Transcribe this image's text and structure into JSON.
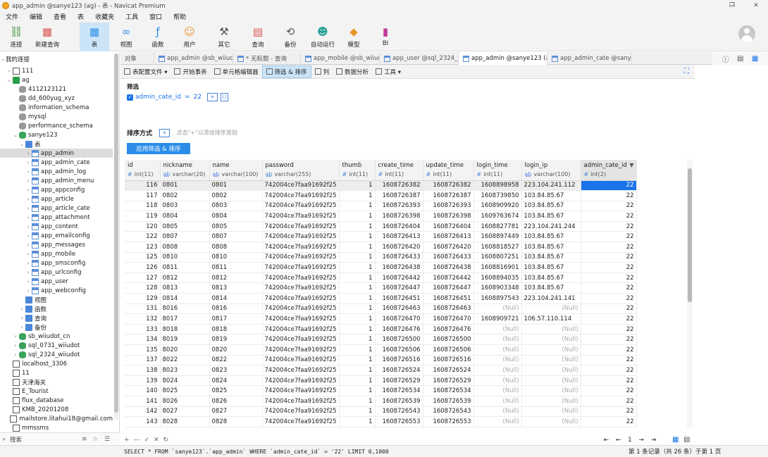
{
  "window": {
    "title": "app_admin @sanye123 (ag) - 表 - Navicat Premium",
    "controls": [
      "—",
      "❐",
      "✕"
    ]
  },
  "menu": [
    "文件",
    "编辑",
    "查看",
    "表",
    "收藏夹",
    "工具",
    "窗口",
    "帮助"
  ],
  "toolbar": [
    {
      "label": "连接",
      "icon": "connection-icon"
    },
    {
      "label": "新建查询",
      "icon": "new-query-icon"
    },
    {
      "label": "表",
      "icon": "table-icon"
    },
    {
      "label": "视图",
      "icon": "view-icon"
    },
    {
      "label": "函数",
      "icon": "function-icon"
    },
    {
      "label": "用户",
      "icon": "user-icon"
    },
    {
      "label": "其它",
      "icon": "tools-icon"
    },
    {
      "label": "查询",
      "icon": "query-icon"
    },
    {
      "label": "备份",
      "icon": "backup-icon"
    },
    {
      "label": "自动运行",
      "icon": "robot-icon"
    },
    {
      "label": "模型",
      "icon": "model-icon"
    },
    {
      "label": "BI",
      "icon": "bi-icon"
    }
  ],
  "sidebar": {
    "header": "我的连接",
    "items": [
      {
        "label": "111",
        "level": 1,
        "icon": "conn2",
        "arrow": "›"
      },
      {
        "label": "ag",
        "level": 1,
        "icon": "conn",
        "arrow": "⌄"
      },
      {
        "label": "4112123121",
        "level": 2,
        "icon": "db-grey",
        "arrow": ""
      },
      {
        "label": "dd_600yug_xyz",
        "level": 2,
        "icon": "db-grey",
        "arrow": ""
      },
      {
        "label": "information_schema",
        "level": 2,
        "icon": "db-grey",
        "arrow": ""
      },
      {
        "label": "mysql",
        "level": 2,
        "icon": "db-grey",
        "arrow": ""
      },
      {
        "label": "performance_schema",
        "level": 2,
        "icon": "db-grey",
        "arrow": ""
      },
      {
        "label": "sanye123",
        "level": 2,
        "icon": "db-g",
        "arrow": "⌄"
      },
      {
        "label": "表",
        "level": 3,
        "icon": "folder",
        "arrow": "⌄"
      },
      {
        "label": "app_admin",
        "level": 4,
        "icon": "tbl",
        "arrow": "›",
        "selected": true
      },
      {
        "label": "app_admin_cate",
        "level": 4,
        "icon": "tbl",
        "arrow": "›"
      },
      {
        "label": "app_admin_log",
        "level": 4,
        "icon": "tbl",
        "arrow": "›"
      },
      {
        "label": "app_admin_menu",
        "level": 4,
        "icon": "tbl",
        "arrow": "›"
      },
      {
        "label": "app_appconfig",
        "level": 4,
        "icon": "tbl",
        "arrow": "›"
      },
      {
        "label": "app_article",
        "level": 4,
        "icon": "tbl",
        "arrow": "›"
      },
      {
        "label": "app_article_cate",
        "level": 4,
        "icon": "tbl",
        "arrow": "›"
      },
      {
        "label": "app_attachment",
        "level": 4,
        "icon": "tbl",
        "arrow": "›"
      },
      {
        "label": "app_content",
        "level": 4,
        "icon": "tbl",
        "arrow": "›"
      },
      {
        "label": "app_emailconfig",
        "level": 4,
        "icon": "tbl",
        "arrow": "›"
      },
      {
        "label": "app_messages",
        "level": 4,
        "icon": "tbl",
        "arrow": "›"
      },
      {
        "label": "app_mobile",
        "level": 4,
        "icon": "tbl",
        "arrow": "›"
      },
      {
        "label": "app_smsconfig",
        "level": 4,
        "icon": "tbl",
        "arrow": "›"
      },
      {
        "label": "app_urlconfig",
        "level": 4,
        "icon": "tbl",
        "arrow": "›"
      },
      {
        "label": "app_user",
        "level": 4,
        "icon": "tbl",
        "arrow": "›"
      },
      {
        "label": "app_webconfig",
        "level": 4,
        "icon": "tbl",
        "arrow": "›"
      },
      {
        "label": "视图",
        "level": 3,
        "icon": "folder",
        "arrow": ""
      },
      {
        "label": "函数",
        "level": 3,
        "icon": "folder",
        "arrow": "›"
      },
      {
        "label": "查询",
        "level": 3,
        "icon": "folder",
        "arrow": "›"
      },
      {
        "label": "备份",
        "level": 3,
        "icon": "folder",
        "arrow": "›"
      },
      {
        "label": "sb_wiiudot_cn",
        "level": 2,
        "icon": "db-g",
        "arrow": "›"
      },
      {
        "label": "sql_0731_wiiudot",
        "level": 2,
        "icon": "db-g",
        "arrow": "›"
      },
      {
        "label": "sql_2324_wiiudot",
        "level": 2,
        "icon": "db-g",
        "arrow": "›"
      },
      {
        "label": "localhost_3306",
        "level": 1,
        "icon": "conn2",
        "arrow": ""
      },
      {
        "label": "11",
        "level": 1,
        "icon": "conn2",
        "arrow": ""
      },
      {
        "label": "天津海关",
        "level": 1,
        "icon": "conn2",
        "arrow": ""
      },
      {
        "label": "E_Tourist",
        "level": 1,
        "icon": "conn2",
        "arrow": ""
      },
      {
        "label": "flux_database",
        "level": 1,
        "icon": "conn2",
        "arrow": ""
      },
      {
        "label": "KMB_20201208",
        "level": 1,
        "icon": "conn2",
        "arrow": ""
      },
      {
        "label": "mailstore.litahui18@gmail.com",
        "level": 1,
        "icon": "conn2",
        "arrow": ""
      },
      {
        "label": "mmssms",
        "level": 1,
        "icon": "conn2",
        "arrow": ""
      }
    ],
    "search_label": "搜索"
  },
  "tabs": [
    {
      "label": "对象",
      "active": false,
      "icon": false
    },
    {
      "label": "app_admin @sb_wiiudot_c...",
      "active": false,
      "icon": true
    },
    {
      "label": "* 无标题 - 查询",
      "active": false,
      "icon": true
    },
    {
      "label": "app_mobile @sb_wiiudot_...",
      "active": false,
      "icon": true
    },
    {
      "label": "app_user @sql_2324_wiiu...",
      "active": false,
      "icon": true
    },
    {
      "label": "app_admin @sanye123 (a...",
      "active": true,
      "icon": true
    },
    {
      "label": "app_admin_cate @sanye1...",
      "active": false,
      "icon": true
    }
  ],
  "subtoolbar": [
    {
      "label": "表配置文件 ▾",
      "active": false
    },
    {
      "label": "开始事务",
      "active": false
    },
    {
      "label": "单元格编辑器",
      "active": false
    },
    {
      "label": "筛选 & 排序",
      "active": true
    },
    {
      "label": "列",
      "active": false
    },
    {
      "label": "数据分析",
      "active": false
    },
    {
      "label": "工具 ▾",
      "active": false
    }
  ],
  "filter": {
    "heading": "筛选",
    "field": "admin_cate_id",
    "operator": "=",
    "value": "22",
    "add_label": "+",
    "group_label": "()"
  },
  "sort": {
    "heading": "排序方式",
    "add_label": "+",
    "hint": "点击\"+\"以添加排序准则",
    "apply_label": "应用筛选 & 排序"
  },
  "grid": {
    "columns": [
      {
        "name": "id",
        "type": "int(11)",
        "kind": "#"
      },
      {
        "name": "nickname",
        "type": "varchar(20)",
        "kind": "abc"
      },
      {
        "name": "name",
        "type": "varchar(100)",
        "kind": "abc"
      },
      {
        "name": "password",
        "type": "varchar(255)",
        "kind": "abc"
      },
      {
        "name": "thumb",
        "type": "int(11)",
        "kind": "#"
      },
      {
        "name": "create_time",
        "type": "int(11)",
        "kind": "#"
      },
      {
        "name": "update_time",
        "type": "int(11)",
        "kind": "#"
      },
      {
        "name": "login_time",
        "type": "int(11)",
        "kind": "#"
      },
      {
        "name": "login_ip",
        "type": "varchar(100)",
        "kind": "abc"
      },
      {
        "name": "admin_cate_id",
        "type": "int(2)",
        "kind": "#"
      }
    ],
    "rows": [
      [
        "116",
        "0801",
        "0801",
        "742004ce7faa91692f25",
        "1",
        "1608726382",
        "1608726382",
        "1608898958",
        "223.104.241.112",
        "22"
      ],
      [
        "117",
        "0802",
        "0802",
        "742004ce7faa91692f25",
        "1",
        "1608726387",
        "1608726387",
        "1608739850",
        "103.84.85.67",
        "22"
      ],
      [
        "118",
        "0803",
        "0803",
        "742004ce7faa91692f25",
        "1",
        "1608726393",
        "1608726393",
        "1608909920",
        "103.84.85.67",
        "22"
      ],
      [
        "119",
        "0804",
        "0804",
        "742004ce7faa91692f25",
        "1",
        "1608726398",
        "1608726398",
        "1609763674",
        "103.84.85.67",
        "22"
      ],
      [
        "120",
        "0805",
        "0805",
        "742004ce7faa91692f25",
        "1",
        "1608726404",
        "1608726404",
        "1608827781",
        "223.104.241.244",
        "22"
      ],
      [
        "122",
        "0807",
        "0807",
        "742004ce7faa91692f25",
        "1",
        "1608726413",
        "1608726413",
        "1608897449",
        "103.84.85.67",
        "22"
      ],
      [
        "123",
        "0808",
        "0808",
        "742004ce7faa91692f25",
        "1",
        "1608726420",
        "1608726420",
        "1608818527",
        "103.84.85.67",
        "22"
      ],
      [
        "125",
        "0810",
        "0810",
        "742004ce7faa91692f25",
        "1",
        "1608726433",
        "1608726433",
        "1608807251",
        "103.84.85.67",
        "22"
      ],
      [
        "126",
        "0811",
        "0811",
        "742004ce7faa91692f25",
        "1",
        "1608726438",
        "1608726438",
        "1608816901",
        "103.84.85.67",
        "22"
      ],
      [
        "127",
        "0812",
        "0812",
        "742004ce7faa91692f25",
        "1",
        "1608726442",
        "1608726442",
        "1608894035",
        "103.84.85.67",
        "22"
      ],
      [
        "128",
        "0813",
        "0813",
        "742004ce7faa91692f25",
        "1",
        "1608726447",
        "1608726447",
        "1608903348",
        "103.84.85.67",
        "22"
      ],
      [
        "129",
        "0814",
        "0814",
        "742004ce7faa91692f25",
        "1",
        "1608726451",
        "1608726451",
        "1608897543",
        "223.104.241.141",
        "22"
      ],
      [
        "131",
        "8016",
        "0816",
        "742004ce7faa91692f25",
        "1",
        "1608726463",
        "1608726463",
        "(Null)",
        "(Null)",
        "22"
      ],
      [
        "132",
        "8017",
        "0817",
        "742004ce7faa91692f25",
        "1",
        "1608726470",
        "1608726470",
        "1608909721",
        "106.57.110.114",
        "22"
      ],
      [
        "133",
        "8018",
        "0818",
        "742004ce7faa91692f25",
        "1",
        "1608726476",
        "1608726476",
        "(Null)",
        "(Null)",
        "22"
      ],
      [
        "134",
        "8019",
        "0819",
        "742004ce7faa91692f25",
        "1",
        "1608726500",
        "1608726500",
        "(Null)",
        "(Null)",
        "22"
      ],
      [
        "135",
        "8020",
        "0820",
        "742004ce7faa91692f25",
        "1",
        "1608726506",
        "1608726506",
        "(Null)",
        "(Null)",
        "22"
      ],
      [
        "137",
        "8022",
        "0822",
        "742004ce7faa91692f25",
        "1",
        "1608726516",
        "1608726516",
        "(Null)",
        "(Null)",
        "22"
      ],
      [
        "138",
        "8023",
        "0823",
        "742004ce7faa91692f25",
        "1",
        "1608726524",
        "1608726524",
        "(Null)",
        "(Null)",
        "22"
      ],
      [
        "139",
        "8024",
        "0824",
        "742004ce7faa91692f25",
        "1",
        "1608726529",
        "1608726529",
        "(Null)",
        "(Null)",
        "22"
      ],
      [
        "140",
        "8025",
        "0825",
        "742004ce7faa91692f25",
        "1",
        "1608726534",
        "1608726534",
        "(Null)",
        "(Null)",
        "22"
      ],
      [
        "141",
        "8026",
        "0826",
        "742004ce7faa91692f25",
        "1",
        "1608726539",
        "1608726539",
        "(Null)",
        "(Null)",
        "22"
      ],
      [
        "142",
        "8027",
        "0827",
        "742004ce7faa91692f25",
        "1",
        "1608726543",
        "1608726543",
        "(Null)",
        "(Null)",
        "22"
      ],
      [
        "143",
        "8028",
        "0828",
        "742004ce7faa91692f25",
        "1",
        "1608726553",
        "1608726553",
        "(Null)",
        "(Null)",
        "22"
      ]
    ],
    "selected_row": 0,
    "selected_col": 9
  },
  "footer": {
    "controls": [
      "+",
      "—",
      "✓",
      "✕",
      "↻"
    ],
    "pager": [
      "⇤",
      "←",
      "1",
      "→",
      "⇥"
    ]
  },
  "status": {
    "sql": "SELECT * FROM `sanye123`.`app_admin` WHERE `admin_cate_id` = '22' LIMIT 0,1000",
    "records": "第 1 条记录（共 26 条）于第 1 页"
  },
  "colors": {
    "accent": "#1a73e8",
    "active_bg": "#cce4f7",
    "apply_btn": "#2b8de8"
  }
}
